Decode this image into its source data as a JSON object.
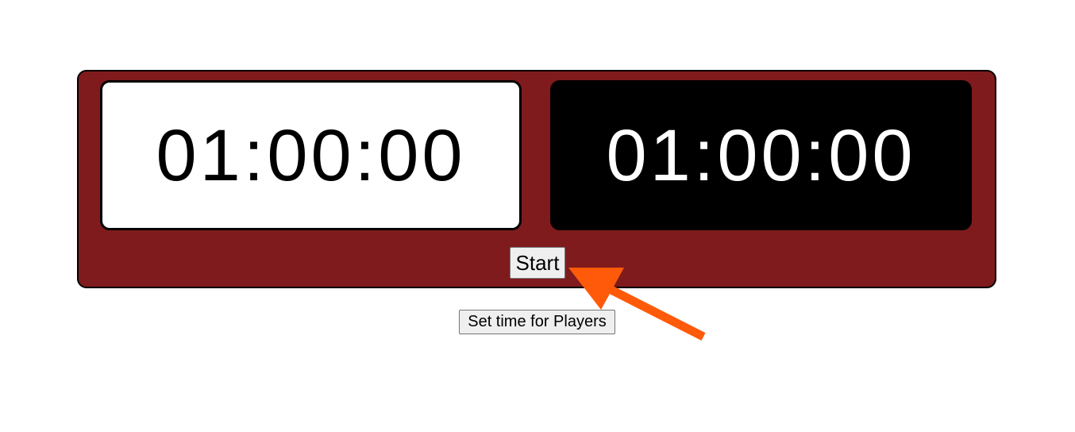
{
  "clocks": {
    "player_one_time": "01:00:00",
    "player_two_time": "01:00:00"
  },
  "controls": {
    "start_label": "Start",
    "set_time_label": "Set time for Players"
  },
  "colors": {
    "frame": "#7f1b1d",
    "player_one_bg": "#ffffff",
    "player_two_bg": "#000000",
    "annotation_arrow": "#ff5a0a"
  },
  "icons": {
    "annotation": "arrow-icon"
  }
}
